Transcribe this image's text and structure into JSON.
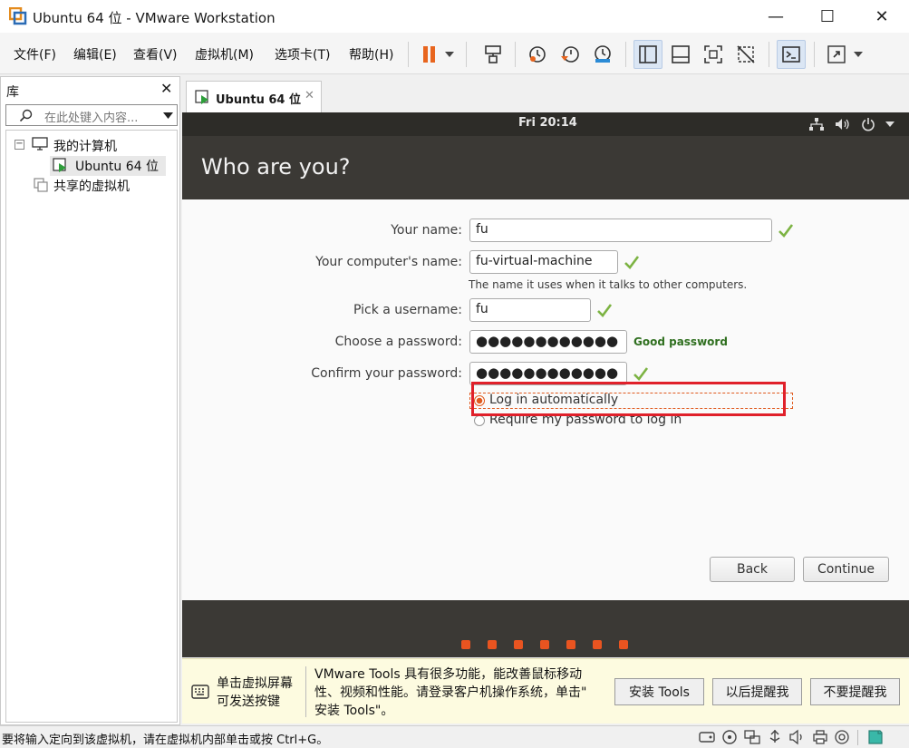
{
  "window": {
    "title": "Ubuntu 64 位 - VMware Workstation",
    "minimize": "—",
    "maximize": "☐",
    "close": "✕"
  },
  "menu": [
    {
      "label": "文件(F)"
    },
    {
      "label": "编辑(E)"
    },
    {
      "label": "查看(V)"
    },
    {
      "label": "虚拟机(M)"
    },
    {
      "label": "选项卡(T)"
    },
    {
      "label": "帮助(H)"
    }
  ],
  "library": {
    "title": "库",
    "close": "✕",
    "search_placeholder": "在此处键入内容...",
    "tree": {
      "my_computer": "我的计算机",
      "vm": "Ubuntu 64 位",
      "shared": "共享的虚拟机"
    }
  },
  "tab": {
    "label": "Ubuntu 64 位",
    "close": "✕"
  },
  "vm_screen": {
    "clock": "Fri 20:14",
    "title": "Who are you?",
    "fields": {
      "name_label": "Your name:",
      "name_value": "fu",
      "computer_label": "Your computer's name:",
      "computer_value": "fu-virtual-machine",
      "computer_hint": "The name it uses when it talks to other computers.",
      "username_label": "Pick a username:",
      "username_value": "fu",
      "password_label": "Choose a password:",
      "password_value": "●●●●●●●●●●●●",
      "password_strength": "Good password",
      "confirm_label": "Confirm your password:",
      "confirm_value": "●●●●●●●●●●●●"
    },
    "options": {
      "auto_login": "Log in automatically",
      "require_password": "Require my password to log in"
    },
    "buttons": {
      "back": "Back",
      "continue": "Continue"
    },
    "progress_dots": 7
  },
  "notice": {
    "left_text": "单击虚拟屏幕可发送按键",
    "left_line1": "单击虚拟屏幕",
    "left_line2": "可发送按键",
    "message_line1": "VMware Tools 具有很多功能，能改善鼠标移动",
    "message_line2": "性、视频和性能。请登录客户机操作系统，单击\"",
    "message_line3": "安装 Tools\"。",
    "install_button": "安装 Tools",
    "later_button": "以后提醒我",
    "never_button": "不要提醒我"
  },
  "status": {
    "text": "要将输入定向到该虚拟机，请在虚拟机内部单击或按 Ctrl+G。"
  },
  "colors": {
    "ubuntu_orange": "#e95420",
    "highlight_red": "#e0202a",
    "check_green": "#7cb342"
  }
}
